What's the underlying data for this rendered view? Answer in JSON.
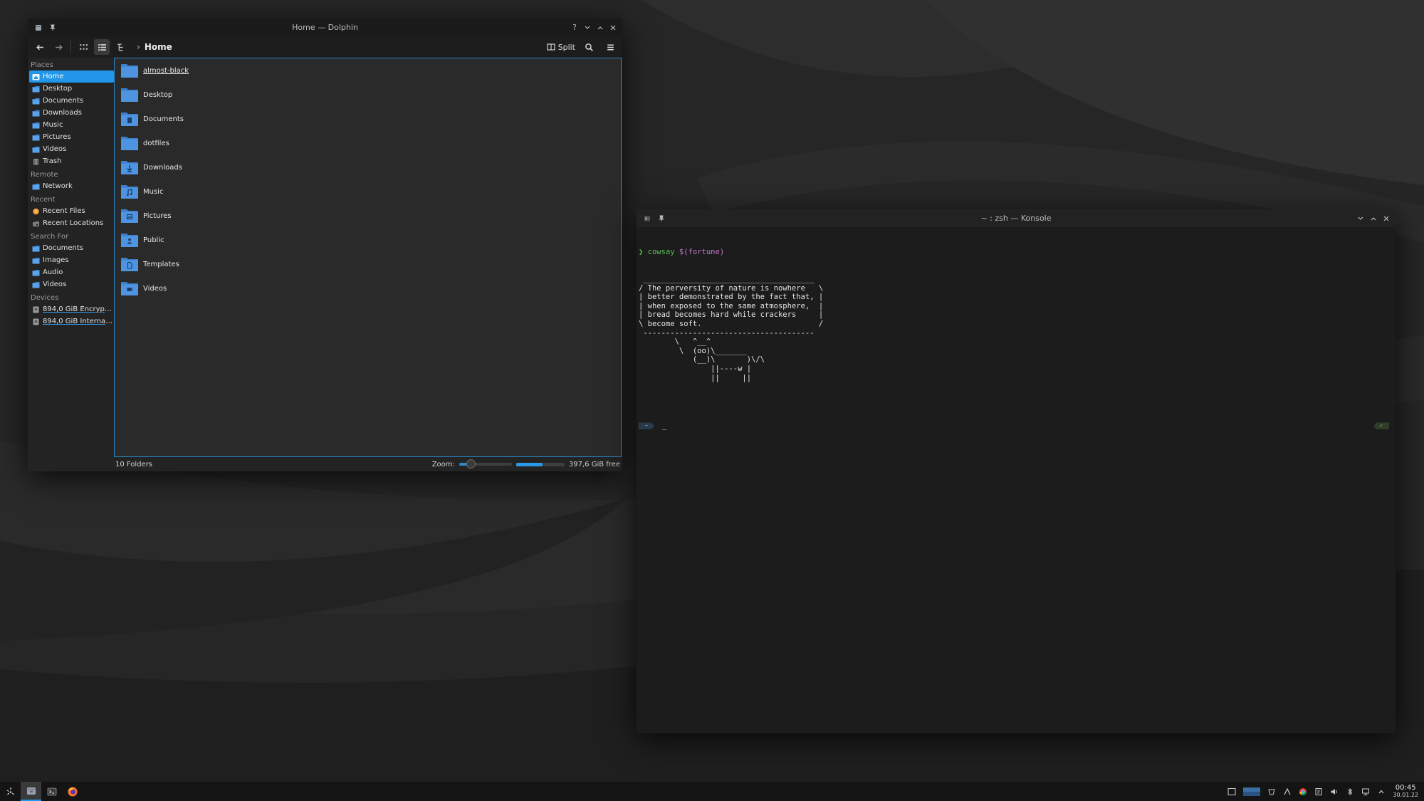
{
  "colors": {
    "accent": "#2296e8",
    "folder": "#4f94e0",
    "terminal_green": "#59c159",
    "terminal_purple": "#c475c4",
    "wallpaper": "#242424"
  },
  "dolphin": {
    "title": "Home — Dolphin",
    "breadcrumb": "Home",
    "split_label": "Split",
    "places": {
      "places_header": "Places",
      "places_items": [
        {
          "label": "Home",
          "icon": "home-icon"
        },
        {
          "label": "Desktop",
          "icon": "desktop-icon"
        },
        {
          "label": "Documents",
          "icon": "documents-icon"
        },
        {
          "label": "Downloads",
          "icon": "downloads-icon"
        },
        {
          "label": "Music",
          "icon": "music-icon"
        },
        {
          "label": "Pictures",
          "icon": "pictures-icon"
        },
        {
          "label": "Videos",
          "icon": "videos-icon"
        },
        {
          "label": "Trash",
          "icon": "trash-icon"
        }
      ],
      "remote_header": "Remote",
      "remote_items": [
        {
          "label": "Network",
          "icon": "network-icon"
        }
      ],
      "recent_header": "Recent",
      "recent_items": [
        {
          "label": "Recent Files",
          "icon": "recent-files-icon"
        },
        {
          "label": "Recent Locations",
          "icon": "recent-locations-icon"
        }
      ],
      "search_header": "Search For",
      "search_items": [
        {
          "label": "Documents",
          "icon": "search-documents-icon"
        },
        {
          "label": "Images",
          "icon": "search-images-icon"
        },
        {
          "label": "Audio",
          "icon": "search-audio-icon"
        },
        {
          "label": "Videos",
          "icon": "search-videos-icon"
        }
      ],
      "devices_header": "Devices",
      "devices_items": [
        {
          "label": "894,0 GiB Encrypted ...",
          "icon": "drive-icon"
        },
        {
          "label": "894,0 GiB Internal Dri...",
          "icon": "drive-icon"
        }
      ]
    },
    "files": [
      {
        "name": "almost-black",
        "glyph": ""
      },
      {
        "name": "Desktop",
        "glyph": ""
      },
      {
        "name": "Documents",
        "glyph": "doc"
      },
      {
        "name": "dotfiles",
        "glyph": ""
      },
      {
        "name": "Downloads",
        "glyph": "download"
      },
      {
        "name": "Music",
        "glyph": "music"
      },
      {
        "name": "Pictures",
        "glyph": "picture"
      },
      {
        "name": "Public",
        "glyph": "user"
      },
      {
        "name": "Templates",
        "glyph": "template"
      },
      {
        "name": "Videos",
        "glyph": "video"
      }
    ],
    "status": {
      "folder_count": "10 Folders",
      "zoom_label": "Zoom:",
      "zoom_level": 0.22,
      "free_space": "397,6 GiB free",
      "used_fraction": 0.55
    }
  },
  "konsole": {
    "title": "~ : zsh — Konsole",
    "prompt_symbol": "❯",
    "command": "cowsay",
    "command_arg": "$(fortune)",
    "output_lines": [
      " ______________________________________",
      "/ The perversity of nature is nowhere   \\",
      "| better demonstrated by the fact that, |",
      "| when exposed to the same atmosphere,  |",
      "| bread becomes hard while crackers     |",
      "\\ become soft.                          /",
      " --------------------------------------",
      "        \\   ^__^",
      "         \\  (oo)\\_______",
      "            (__)\\       )\\/\\",
      "                ||----w |",
      "                ||     ||"
    ],
    "prompt_dir": "~",
    "cursor": "_",
    "status_check": "✓"
  },
  "taskbar": {
    "clock_time": "00:45",
    "clock_date": "30.01.22"
  }
}
